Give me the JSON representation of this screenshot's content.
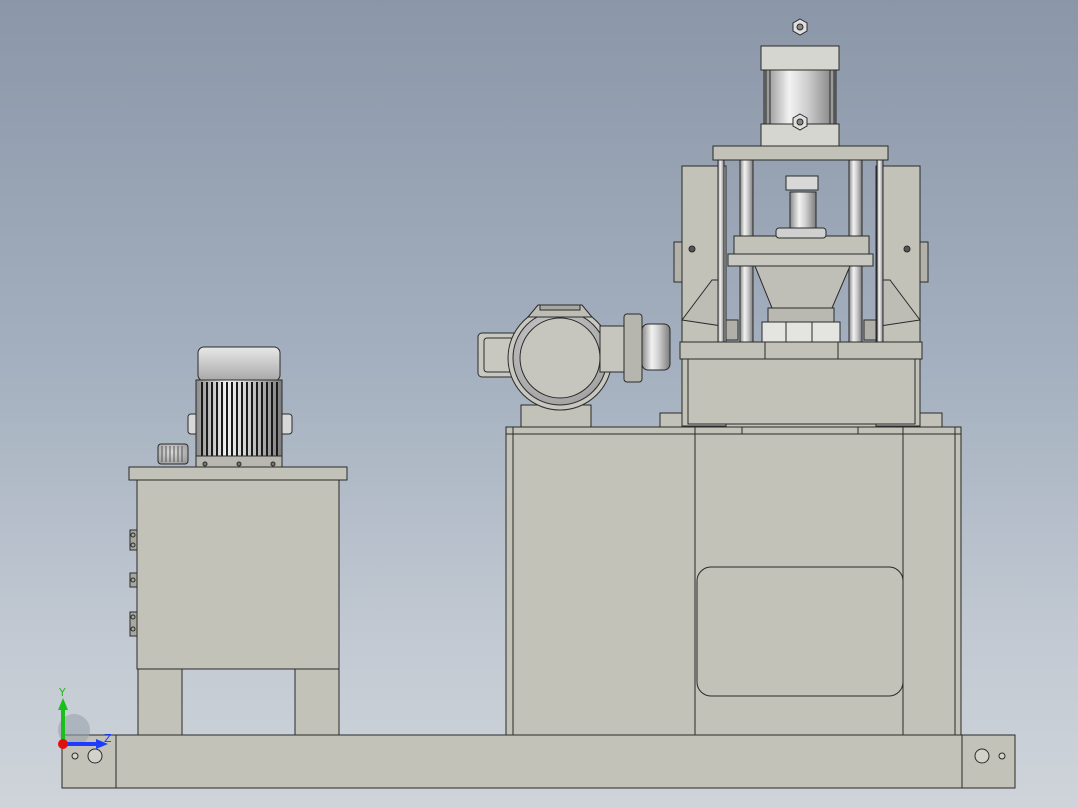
{
  "viewport": {
    "background_top": "#8b97a8",
    "background_bottom": "#cfd4da"
  },
  "model": {
    "part_color": "#c2c2b8",
    "edge_color": "#2a2a2a",
    "metal_light": "#e6e6e6",
    "metal_dark": "#6a6a6a"
  },
  "triad": {
    "y_label": "Y",
    "z_label": "Z",
    "y_color": "#19c01b",
    "z_color": "#1e3cff",
    "x_color": "#e01010"
  }
}
